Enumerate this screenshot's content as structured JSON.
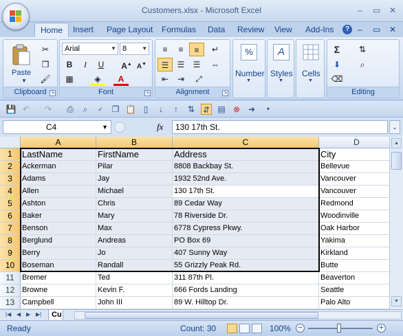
{
  "window": {
    "title": "Customers.xlsx - Microsoft Excel",
    "minimize": "–",
    "restore": "▭",
    "close": "✕"
  },
  "ribbon": {
    "tabs": [
      "Home",
      "Insert",
      "Page Layout",
      "Formulas",
      "Data",
      "Review",
      "View",
      "Add-Ins"
    ],
    "active_tab": "Home",
    "clipboard": {
      "label": "Clipboard",
      "paste": "Paste"
    },
    "font": {
      "label": "Font",
      "name": "Arial",
      "size": "8"
    },
    "alignment": {
      "label": "Alignment"
    },
    "number": {
      "label": "Number",
      "symbol": "%"
    },
    "styles": {
      "label": "Styles"
    },
    "cells": {
      "label": "Cells"
    },
    "editing": {
      "label": "Editing",
      "sum_symbol": "Σ"
    }
  },
  "formula_bar": {
    "name_box": "C4",
    "fx": "fx",
    "formula": "130 17th St."
  },
  "sheet": {
    "columns": [
      "A",
      "B",
      "C",
      "D"
    ],
    "selected_columns": [
      "A",
      "B",
      "C"
    ],
    "active_cell": "C4",
    "rows": [
      {
        "num": "1",
        "cells": [
          "LastName",
          "FirstName",
          "Address",
          "City"
        ]
      },
      {
        "num": "2",
        "cells": [
          "Ackerman",
          "Pilar",
          "8808 Backbay St.",
          "Bellevue"
        ]
      },
      {
        "num": "3",
        "cells": [
          "Adams",
          "Jay",
          "1932 52nd Ave.",
          "Vancouver"
        ]
      },
      {
        "num": "4",
        "cells": [
          "Allen",
          "Michael",
          "130 17th St.",
          "Vancouver"
        ]
      },
      {
        "num": "5",
        "cells": [
          "Ashton",
          "Chris",
          "89 Cedar Way",
          "Redmond"
        ]
      },
      {
        "num": "6",
        "cells": [
          "Baker",
          "Mary",
          "78 Riverside Dr.",
          "Woodinville"
        ]
      },
      {
        "num": "7",
        "cells": [
          "Benson",
          "Max",
          "6778 Cypress Pkwy.",
          "Oak Harbor"
        ]
      },
      {
        "num": "8",
        "cells": [
          "Berglund",
          "Andreas",
          "PO Box 69",
          "Yakima"
        ]
      },
      {
        "num": "9",
        "cells": [
          "Berry",
          "Jo",
          "407 Sunny Way",
          "Kirkland"
        ]
      },
      {
        "num": "10",
        "cells": [
          "Boseman",
          "Randall",
          "55 Grizzly Peak Rd.",
          "Butte"
        ]
      },
      {
        "num": "11",
        "cells": [
          "Bremer",
          "Ted",
          "311 87th Pl.",
          "Beaverton"
        ]
      },
      {
        "num": "12",
        "cells": [
          "Browne",
          "Kevin F.",
          "666 Fords Landing",
          "Seattle"
        ]
      },
      {
        "num": "13",
        "cells": [
          "Campbell",
          "John III",
          "89 W. Hilltop Dr.",
          "Palo Alto"
        ]
      }
    ],
    "sheet_tab": "Cu"
  },
  "status_bar": {
    "ready": "Ready",
    "count": "Count: 30",
    "zoom": "100%"
  },
  "colors": {
    "selection_header": "#f6c66e",
    "selection_fill": "#e6eaf3",
    "ribbon_blue": "#15428b"
  }
}
